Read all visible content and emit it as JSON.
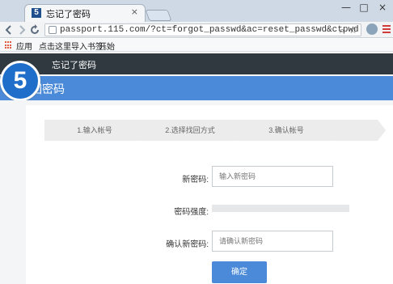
{
  "browser": {
    "tab": {
      "favicon_text": "5",
      "title": "忘记了密码",
      "close_symbol": "×"
    },
    "window_controls": [
      "—",
      "□",
      "×"
    ],
    "url": "passport.115.com/?ct=forgot_passwd&ac=reset_passwd&ctpwd",
    "bookmarks": {
      "apps_label": "应用",
      "import_hint": "点击这里导入书签。",
      "start_label": "开始"
    },
    "icons": {
      "back": "back-arrow-icon",
      "forward": "forward-arrow-icon",
      "reload": "reload-icon",
      "search": "search-icon",
      "star": "bookmark-star-icon",
      "globe": "globe-icon",
      "menu": "menu-icon"
    }
  },
  "site": {
    "badge_text": "5",
    "header_title": "忘记了密码",
    "section_title": "回密码"
  },
  "steps": [
    {
      "label": "1.输入帐号"
    },
    {
      "label": "2.选择找回方式"
    },
    {
      "label": "3.确认帐号"
    },
    {
      "label": ""
    }
  ],
  "form": {
    "new_password": {
      "label": "新密码:",
      "placeholder": "输入新密码"
    },
    "strength": {
      "label": "密码强度:",
      "value": 0
    },
    "confirm_password": {
      "label": "确认新密码:",
      "placeholder": "请确认新密码"
    },
    "submit_label": "确定"
  },
  "colors": {
    "header_dark": "#303940",
    "brand_blue": "#4b8ad8",
    "badge_blue": "#1f6ec9"
  }
}
